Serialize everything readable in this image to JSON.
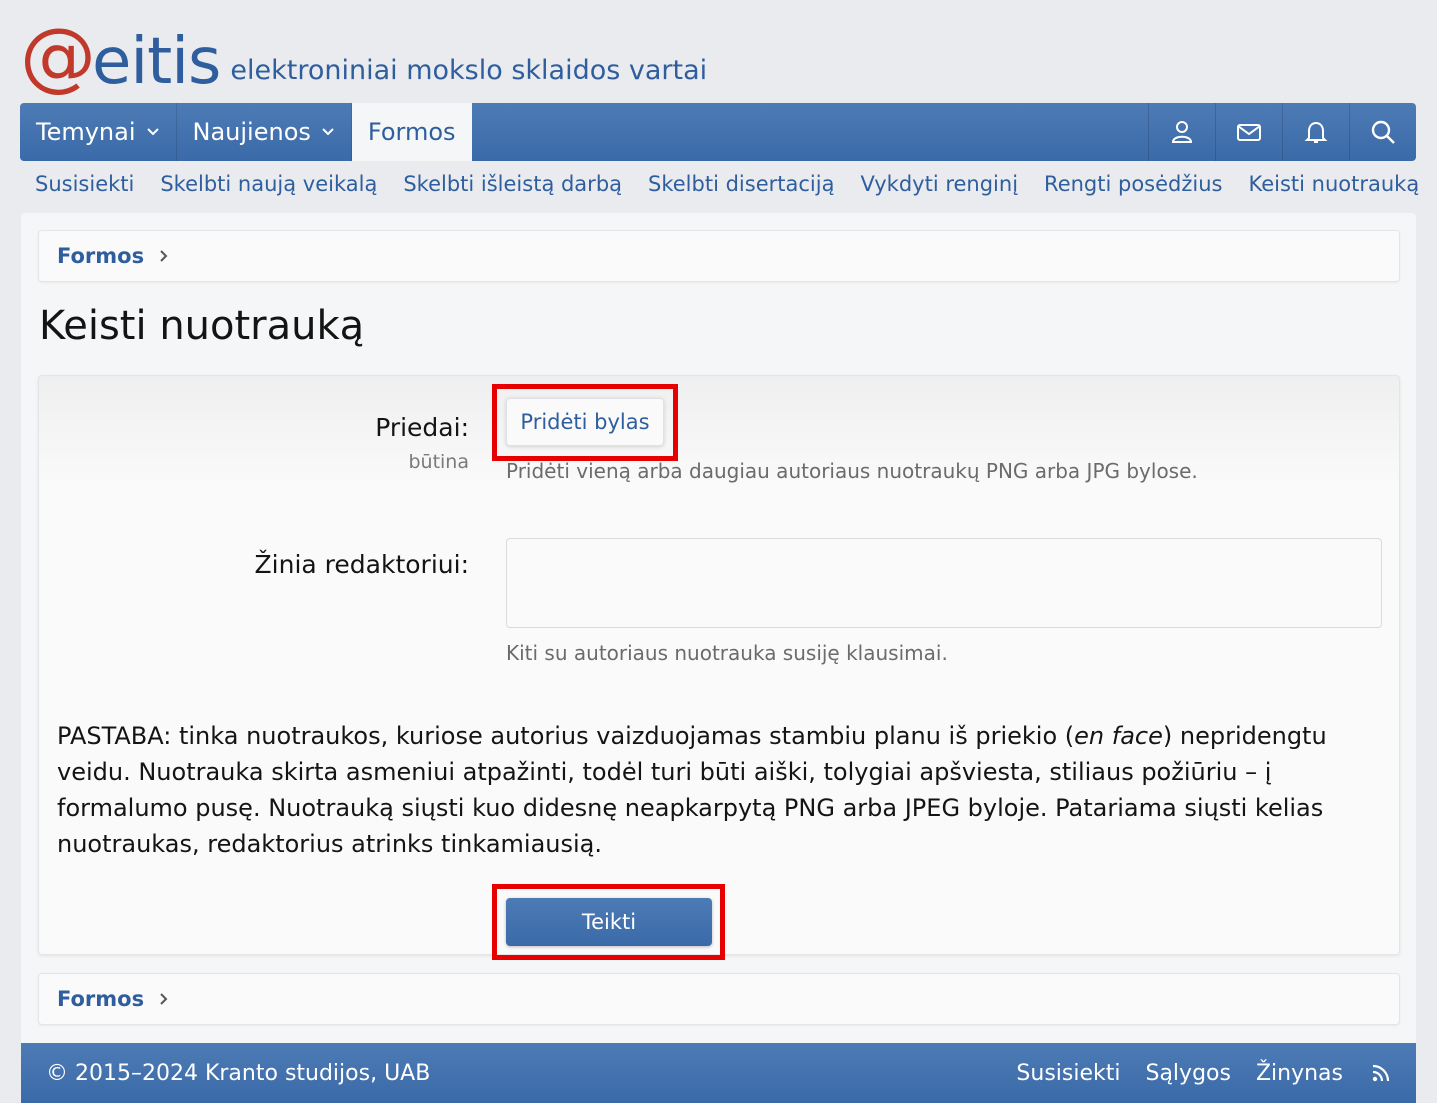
{
  "logo": {
    "at": "@",
    "name": "eitis",
    "tagline": "elektroniniai mokslo sklaidos vartai"
  },
  "nav": {
    "tabs": [
      {
        "label": "Temynai",
        "has_dropdown": true
      },
      {
        "label": "Naujienos",
        "has_dropdown": true
      },
      {
        "label": "Formos",
        "active": true
      }
    ],
    "icons": [
      "user-icon",
      "envelope-icon",
      "bell-icon",
      "search-icon"
    ]
  },
  "subnav": [
    "Susisiekti",
    "Skelbti naują veikalą",
    "Skelbti išleistą darbą",
    "Skelbti disertaciją",
    "Vykdyti renginį",
    "Rengti posėdžius",
    "Keisti nuotrauką"
  ],
  "breadcrumb": "Formos",
  "page_title": "Keisti nuotrauką",
  "form": {
    "attachments_label": "Priedai:",
    "attachments_required": "būtina",
    "attach_button": "Pridėti bylas",
    "attachments_explain": "Pridėti vieną arba daugiau autoriaus nuotraukų PNG arba JPG bylose.",
    "message_label": "Žinia redaktoriui:",
    "message_value": "",
    "message_explain": "Kiti su autoriaus nuotrauka susiję klausimai.",
    "note_pre": "PASTABA: tinka nuotraukos, kuriose autorius vaizduojamas stambiu planu iš priekio (",
    "note_em": "en face",
    "note_post": ") nepridengtu veidu. Nuotrauka skirta asmeniui atpažinti, todėl turi būti aiški, tolygiai apšviesta, stiliaus požiūriu – į formalumo pusę. Nuotrauką siųsti kuo didesnę neapkarpytą PNG arba JPEG byloje. Patariama siųsti kelias nuotraukas, redaktorius atrinks tinkamiausią.",
    "submit_button": "Teikti"
  },
  "footer": {
    "copyright": "© 2015–2024 Kranto studijos, UAB",
    "links": [
      "Susisiekti",
      "Sąlygos",
      "Žinynas"
    ],
    "rss_icon": "rss-icon"
  },
  "colors": {
    "brand": "#3a6aa8",
    "logo_at": "#c0392b",
    "highlight": "#e60000"
  }
}
